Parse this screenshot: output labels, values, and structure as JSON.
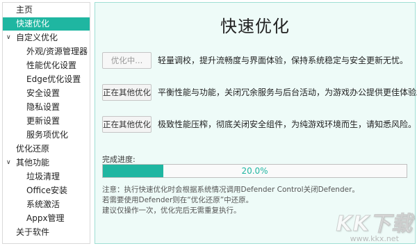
{
  "sidebar": {
    "items": [
      {
        "label": "主页",
        "level": 0
      },
      {
        "label": "快速优化",
        "level": 0,
        "active": true
      },
      {
        "label": "自定义优化",
        "level": 0,
        "expandable": true
      },
      {
        "label": "外观/资源管理器",
        "level": 1
      },
      {
        "label": "性能优化设置",
        "level": 1
      },
      {
        "label": "Edge优化设置",
        "level": 1
      },
      {
        "label": "安全设置",
        "level": 1
      },
      {
        "label": "隐私设置",
        "level": 1
      },
      {
        "label": "更新设置",
        "level": 1
      },
      {
        "label": "服务项优化",
        "level": 1
      },
      {
        "label": "优化还原",
        "level": 0
      },
      {
        "label": "其他功能",
        "level": 0,
        "expandable": true
      },
      {
        "label": "垃圾清理",
        "level": 1
      },
      {
        "label": "Office安装",
        "level": 1
      },
      {
        "label": "系统激活",
        "level": 1
      },
      {
        "label": "Appx管理",
        "level": 1
      },
      {
        "label": "关于软件",
        "level": 0
      }
    ]
  },
  "main": {
    "title": "快速优化",
    "modes": [
      {
        "button": "优化中...",
        "disabled": true,
        "description": "轻量调校，提升流畅度与界面体验，保持系统稳定与安全更新无忧。"
      },
      {
        "button": "正在其他优化",
        "disabled": false,
        "description": "平衡性能与功能，关闭冗余服务与后台活动，为游戏办公提供更佳体验。"
      },
      {
        "button": "正在其他优化",
        "disabled": false,
        "description": "极致性能压榨，彻底关闭安全组件，为纯游戏环境而生，请知悉风险。"
      }
    ],
    "progress": {
      "label": "完成进度:",
      "value": 0.2,
      "text": "20.0%"
    },
    "notes": [
      "注意：执行快速优化时会根据系统情况调用Defender Control关闭Defender。",
      "若需要使用Defender则在“优化还原”中还原。",
      "建议仅操作一次，优化完后无需重复执行。"
    ]
  },
  "watermark": {
    "logo": "KK下载",
    "url": "www.kkx.net"
  },
  "colors": {
    "accent": "#1fb6a1",
    "panel_bg": "#eefbf8",
    "panel_border": "#9fded4"
  },
  "icons": {
    "expand": "chevron-down-icon"
  }
}
